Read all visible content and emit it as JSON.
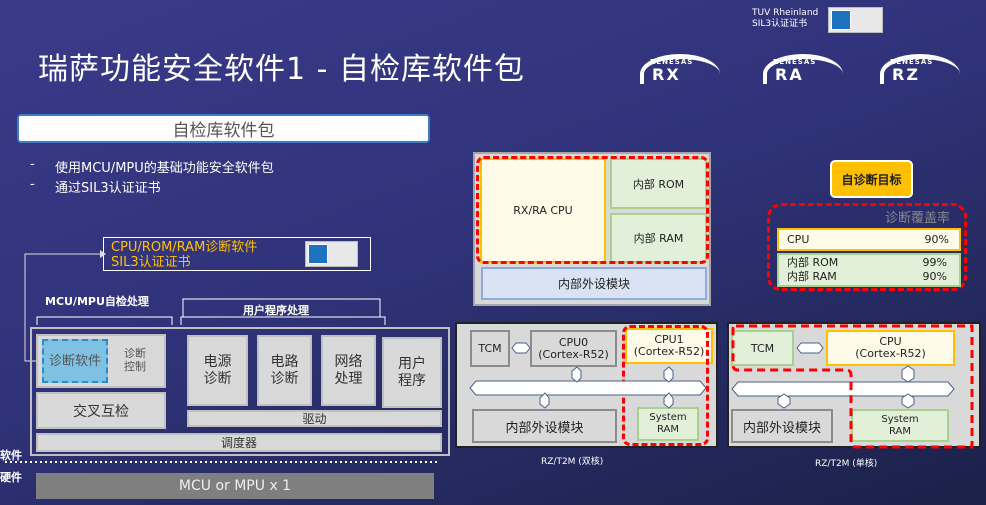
{
  "title": "瑞萨功能安全软件1 - 自检库软件包",
  "tuv": {
    "line1": "TUV Rheinland",
    "line2": "SIL3认证证书"
  },
  "logos": [
    {
      "brand": "RENESAS",
      "product": "RX"
    },
    {
      "brand": "RENESAS",
      "product": "RA"
    },
    {
      "brand": "RENESAS",
      "product": "RZ"
    }
  ],
  "package_label": "自检库软件包",
  "bullets": [
    "使用MCU/MPU的基础功能安全软件包",
    "通过SIL3认证证书"
  ],
  "bullet_dash": "-",
  "cert_box": {
    "line1": "CPU/ROM/RAM诊断软件",
    "line2": "SIL3认证证书"
  },
  "stack": {
    "self_check_label": "MCU/MPU自检处理",
    "user_label": "用户程序处理",
    "diag_sw": "诊断软件",
    "diag_ctrl": "诊断控制",
    "cross_check": "交叉互检",
    "modules": [
      "电源诊断",
      "电路诊断",
      "网络处理",
      "用户程序"
    ],
    "driver": "驱动",
    "scheduler": "调度器",
    "software": "软件",
    "hardware": "硬件",
    "hw_box": "MCU or MPU x 1"
  },
  "rxra": {
    "cpu": "RX/RA CPU",
    "rom": "内部  ROM",
    "ram": "内部  RAM",
    "periph": "内部外设模块"
  },
  "target": {
    "button": "自诊断目标",
    "coverage_title": "诊断覆盖率",
    "rows": [
      {
        "name": "CPU",
        "value": "90%"
      },
      {
        "name": "内部  ROM",
        "value": "99%"
      },
      {
        "name": "内部  RAM",
        "value": "90%"
      }
    ]
  },
  "rz_dual": {
    "tcm": "TCM",
    "cpu0": "CPU0",
    "cpu0_sub": "(Cortex-R52)",
    "cpu1": "CPU1",
    "cpu1_sub": "(Cortex-R52)",
    "periph": "内部外设模块",
    "sysram1": "System",
    "sysram2": "RAM",
    "caption": "RZ/T2M (双核)"
  },
  "rz_single": {
    "tcm": "TCM",
    "cpu": "CPU",
    "cpu_sub": "(Cortex-R52)",
    "periph": "内部外设模块",
    "sysram1": "System",
    "sysram2": "RAM",
    "caption": "RZ/T2M (单核)"
  },
  "colors": {
    "accent_yellow": "#ffc000",
    "red_dash": "#ff0000",
    "green": "#a9d18e"
  }
}
